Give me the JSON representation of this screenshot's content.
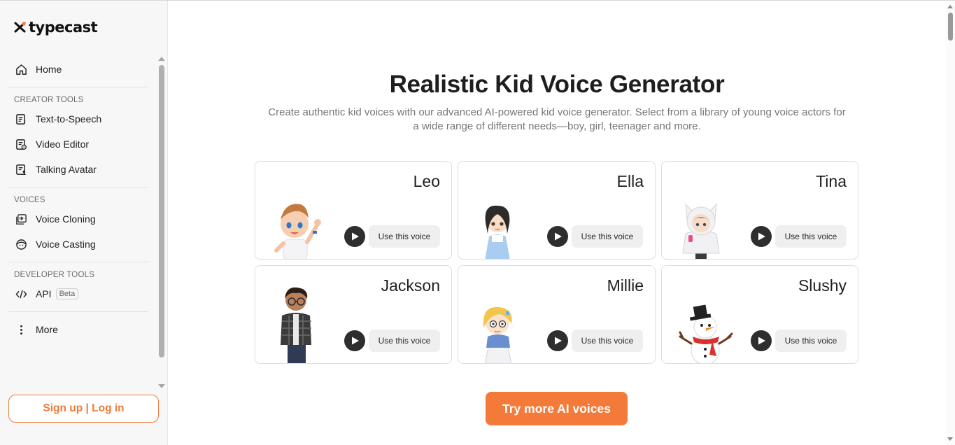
{
  "brand": {
    "name": "typecast"
  },
  "sidebar": {
    "home_label": "Home",
    "sections": [
      {
        "title": "CREATOR TOOLS",
        "items": [
          "Text-to-Speech",
          "Video Editor",
          "Talking Avatar"
        ]
      },
      {
        "title": "VOICES",
        "items": [
          "Voice Cloning",
          "Voice Casting"
        ]
      },
      {
        "title": "DEVELOPER TOOLS",
        "items": [
          "API"
        ]
      }
    ],
    "api_badge": "Beta",
    "more_label": "More",
    "signup_label": "Sign up | Log in"
  },
  "main": {
    "title": "Realistic Kid Voice Generator",
    "subtitle": "Create authentic kid voices with our advanced AI-powered kid voice generator. Select from a library of young voice actors for a wide range of different needs—boy, girl, teenager and more.",
    "voices": [
      {
        "name": "Leo",
        "use_label": "Use this voice",
        "avatar_icon": "kid-boy-avatar"
      },
      {
        "name": "Ella",
        "use_label": "Use this voice",
        "avatar_icon": "kid-girl-avatar"
      },
      {
        "name": "Tina",
        "use_label": "Use this voice",
        "avatar_icon": "hoodie-girl-avatar"
      },
      {
        "name": "Jackson",
        "use_label": "Use this voice",
        "avatar_icon": "teen-boy-avatar"
      },
      {
        "name": "Millie",
        "use_label": "Use this voice",
        "avatar_icon": "blonde-girl-avatar"
      },
      {
        "name": "Slushy",
        "use_label": "Use this voice",
        "avatar_icon": "snowman-avatar"
      }
    ],
    "cta_label": "Try more AI voices"
  },
  "colors": {
    "accent": "#f47a3a",
    "play": "#2e2e2e",
    "sidebar_bg": "#f7f7f7"
  }
}
